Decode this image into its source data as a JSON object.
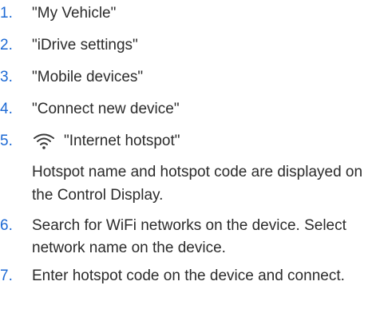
{
  "steps": [
    {
      "number": "1.",
      "text": "\"My Vehicle\""
    },
    {
      "number": "2.",
      "text": "\"iDrive settings\""
    },
    {
      "number": "3.",
      "text": "\"Mobile devices\""
    },
    {
      "number": "4.",
      "text": "\"Connect new device\""
    },
    {
      "number": "5.",
      "text": "\"Internet hotspot\"",
      "icon": "wifi-icon"
    },
    {
      "number": "6.",
      "text": "Search for WiFi networks on the device. Se­lect network name on the device."
    },
    {
      "number": "7.",
      "text": "Enter hotspot code on the device and con­nect."
    }
  ],
  "note": "Hotspot name and hotspot code are dis­played on the Control Display.",
  "colors": {
    "step_number": "#1c69d4",
    "text": "#2b2b2b"
  }
}
